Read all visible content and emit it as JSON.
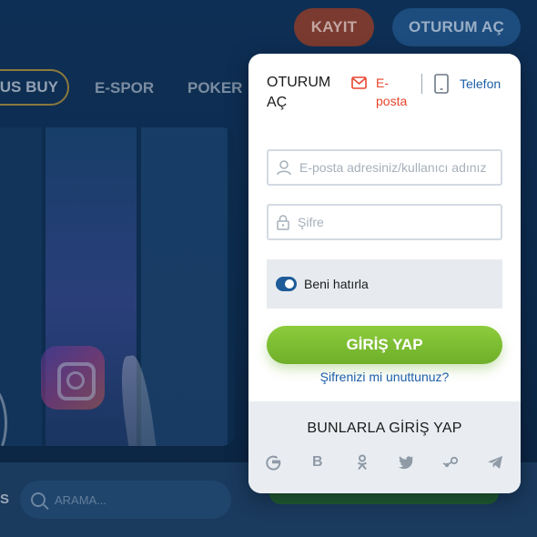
{
  "header": {
    "register_label": "KAYIT",
    "login_label": "OTURUM AÇ"
  },
  "nav": {
    "bonus_label": "NUS BUY",
    "esport_label": "E-SPOR",
    "poker_label": "POKER"
  },
  "bottom": {
    "partial_label": "S",
    "search_placeholder": "ARAMA..."
  },
  "popup": {
    "title": "OTURUM AÇ",
    "tab_email": "E-posta",
    "tab_phone": "Telefon",
    "email_placeholder": "E-posta adresiniz/kullanıcı adınız",
    "password_placeholder": "Şifre",
    "remember_label": "Beni hatırla",
    "remember_checked": true,
    "submit_label": "GİRİŞ YAP",
    "forgot_label": "Şifrenizi mi unuttunuz?",
    "social_title": "BUNLARLA GİRİŞ YAP",
    "social_icons": [
      "google-icon",
      "b-icon",
      "odnoklassniki-icon",
      "twitter-icon",
      "steam-icon",
      "telegram-icon"
    ]
  },
  "colors": {
    "accent_orange": "#e8462e",
    "link_blue": "#1c5ea8",
    "submit_green": "#7dbd33"
  }
}
